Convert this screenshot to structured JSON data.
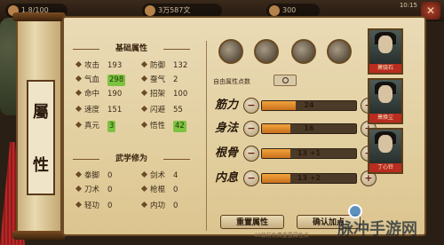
{
  "topbar": {
    "res1": "1.8/100",
    "res2": "3万587文",
    "res3": "300",
    "clock": "10:15"
  },
  "scroll": {
    "char1": "屬",
    "char2": "性"
  },
  "basic": {
    "title": "基础属性",
    "left": [
      {
        "name": "攻击",
        "value": "193",
        "highlight": false
      },
      {
        "name": "气血",
        "value": "298",
        "highlight": true
      },
      {
        "name": "命中",
        "value": "190",
        "highlight": false
      },
      {
        "name": "速度",
        "value": "151",
        "highlight": false
      },
      {
        "name": "真元",
        "value": "3",
        "highlight": true
      }
    ],
    "right": [
      {
        "name": "防御",
        "value": "132",
        "highlight": false
      },
      {
        "name": "蚕气",
        "value": "2",
        "highlight": false
      },
      {
        "name": "招架",
        "value": "100",
        "highlight": false
      },
      {
        "name": "闪避",
        "value": "55",
        "highlight": false
      },
      {
        "name": "悟性",
        "value": "42",
        "highlight": true
      }
    ]
  },
  "martial": {
    "title": "武学修为",
    "left": [
      {
        "name": "拳脚",
        "value": "0"
      },
      {
        "name": "刀术",
        "value": "0"
      },
      {
        "name": "轻功",
        "value": "0"
      }
    ],
    "right": [
      {
        "name": "剑术",
        "value": "4"
      },
      {
        "name": "枪棍",
        "value": "0"
      },
      {
        "name": "内功",
        "value": "0"
      }
    ]
  },
  "free_points": {
    "label": "自由属性点数",
    "value": "0"
  },
  "attributes": [
    {
      "label": "筋力",
      "value": "24",
      "fill": 0.36
    },
    {
      "label": "身法",
      "value": "16",
      "fill": 0.3
    },
    {
      "label": "根骨",
      "value": "13 +1",
      "fill": 0.3
    },
    {
      "label": "内息",
      "value": "13 +2",
      "fill": 0.3
    }
  ],
  "buttons": {
    "reset": "重置属性",
    "confirm": "确认加点"
  },
  "hint": "40级前免费重置属性点",
  "portraits": [
    {
      "name": "萧骁石"
    },
    {
      "name": "萧焕尘"
    },
    {
      "name": "丁心铃"
    }
  ],
  "watermark": "脉冲手游网"
}
